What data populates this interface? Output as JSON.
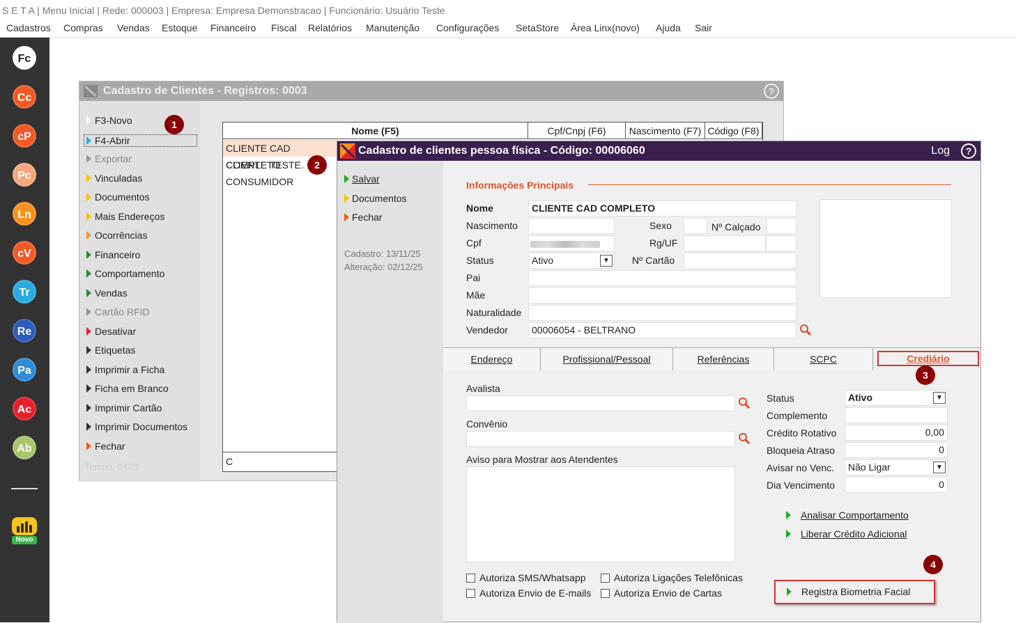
{
  "window_title": "S E T A | Menu Inicial | Rede: 000003 | Empresa: Empresa Demonstracao | Funcionário: Usuário Teste",
  "menu": [
    "Cadastros",
    "Compras",
    "Vendas",
    "Estoque",
    "Financeiro",
    "Fiscal",
    "Relatórios",
    "Manutenção",
    "Configurações",
    "SetaStore",
    "Área Linx(novo)",
    "Ajuda",
    "Sair"
  ],
  "apps": [
    {
      "label": "Fc",
      "color": "#ffffff",
      "text": "#222222"
    },
    {
      "label": "Cc",
      "color": "#f15a24",
      "text": "#ffffff"
    },
    {
      "label": "cP",
      "color": "#f15a24",
      "text": "#ffffff"
    },
    {
      "label": "Pc",
      "color": "#f7a77e",
      "text": "#ffffff"
    },
    {
      "label": "Ln",
      "color": "#f7931e",
      "text": "#ffffff"
    },
    {
      "label": "cV",
      "color": "#f15a24",
      "text": "#ffffff"
    },
    {
      "label": "Tr",
      "color": "#29abe2",
      "text": "#ffffff"
    },
    {
      "label": "Re",
      "color": "#2e5cb8",
      "text": "#ffffff"
    },
    {
      "label": "Pa",
      "color": "#2e8bd8",
      "text": "#ffffff"
    },
    {
      "label": "Ac",
      "color": "#e8202a",
      "text": "#ffffff"
    },
    {
      "label": "Ab",
      "color": "#a8c66c",
      "text": "#ffffff"
    }
  ],
  "novo_label": "Novo",
  "back": {
    "title": "Cadastro de Clientes - Registros: 0003",
    "help": "?",
    "sidebar": [
      {
        "label": "F3-Novo",
        "color": "#ffffff"
      },
      {
        "label": "F4-Abrir",
        "color": "#29abe2"
      },
      {
        "label": "Exportar",
        "color": "#999999"
      },
      {
        "label": "Vinculadas",
        "color": "#f5c400"
      },
      {
        "label": "Documentos",
        "color": "#f5c400"
      },
      {
        "label": "Mais Endereços",
        "color": "#f5c400"
      },
      {
        "label": "Ocorrências",
        "color": "#f7931e"
      },
      {
        "label": "Financeiro",
        "color": "#2a8a2a"
      },
      {
        "label": "Comportamento",
        "color": "#2a8a2a"
      },
      {
        "label": "Vendas",
        "color": "#2a8a2a"
      },
      {
        "label": "Cartão RFID",
        "color": "#999999"
      },
      {
        "label": "Desativar",
        "color": "#e8202a"
      },
      {
        "label": "Etiquetas",
        "color": "#333333"
      },
      {
        "label": "Imprimir a Ficha",
        "color": "#333333"
      },
      {
        "label": "Ficha em Branco",
        "color": "#333333"
      },
      {
        "label": "Imprimir Cartão",
        "color": "#333333"
      },
      {
        "label": "Imprimir Documentos",
        "color": "#333333"
      },
      {
        "label": "Fechar",
        "color": "#f15a24"
      }
    ],
    "tempo": "Tempo:  0,021",
    "columns": [
      "Nome (F5)",
      "Cpf/Cnpj (F6)",
      "Nascimento (F7)",
      "Código (F8)"
    ],
    "rows": [
      "CLIENTE CAD COMPLETO",
      "CLIENTE TESTE.",
      "CONSUMIDOR"
    ],
    "search_value": "C"
  },
  "front": {
    "title": "Cadastro de clientes pessoa física - Código: 00006060",
    "log": "Log",
    "help": "?",
    "actions": [
      "Salvar",
      "Documentos",
      "Fechar"
    ],
    "cadastro": "Cadastro: 13/11/25",
    "alteracao": "Alteração: 02/12/25",
    "section": "Informações Principais",
    "nome_label": "Nome",
    "nome_value": "CLIENTE CAD COMPLETO",
    "nascimento_label": "Nascimento",
    "sexo_label": "Sexo",
    "calcado_label": "Nº Calçado",
    "cpf_label": "Cpf",
    "rg_label": "Rg/UF",
    "status_label": "Status",
    "status_value": "Ativo",
    "cartao_label": "Nº Cartão",
    "pai_label": "Pai",
    "mae_label": "Mãe",
    "naturalidade_label": "Naturalidade",
    "vendedor_label": "Vendedor",
    "vendedor_value": "00006054 - BELTRANO",
    "tabs": [
      "Endereço",
      "Profissional/Pessoal",
      "Referências",
      "SCPC",
      "Crediário"
    ],
    "avalista_label": "Avalista",
    "convenio_label": "Convênio",
    "aviso_label": "Aviso para Mostrar aos Atendentes",
    "checks": [
      "Autoriza SMS/Whatsapp",
      "Autoriza Ligações Telefônicas",
      "Autoriza Envio de E-mails",
      "Autoriza Envio de Cartas"
    ],
    "cred": {
      "status_label": "Status",
      "status_value": "Ativo",
      "complemento_label": "Complemento",
      "credito_label": "Crédito Rotativo",
      "credito_value": "0,00",
      "bloqueia_label": "Bloqueia Atraso",
      "bloqueia_value": "0",
      "avisar_label": "Avisar no Venc.",
      "avisar_value": "Não Ligar",
      "dia_label": "Dia Vencimento",
      "dia_value": "0"
    },
    "links": [
      "Analisar Comportamento",
      "Liberar Crédito Adicional",
      "Registra Biometria Facial"
    ]
  },
  "badges": [
    "1",
    "2",
    "3",
    "4"
  ]
}
